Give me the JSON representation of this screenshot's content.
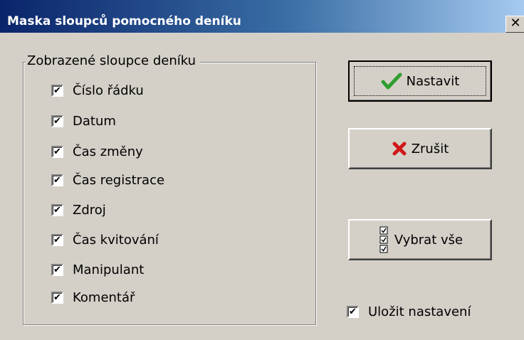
{
  "window": {
    "title": "Maska sloupců pomocného deníku",
    "close_glyph": "✕"
  },
  "group": {
    "legend": "Zobrazené sloupce deníku",
    "items": [
      {
        "label": "Číslo řádku",
        "checked": true
      },
      {
        "label": "Datum",
        "checked": true
      },
      {
        "label": "Čas změny",
        "checked": true
      },
      {
        "label": "Čas registrace",
        "checked": true
      },
      {
        "label": "Zdroj",
        "checked": true
      },
      {
        "label": "Čas kvitování",
        "checked": true
      },
      {
        "label": "Manipulant",
        "checked": true
      },
      {
        "label": "Komentář",
        "checked": true
      }
    ]
  },
  "buttons": {
    "ok": {
      "label": "Nastavit",
      "icon": "checkmark-icon",
      "icon_color": "#2e9e2e"
    },
    "cancel": {
      "label": "Zrušit",
      "icon": "x-icon",
      "icon_color": "#d01818"
    },
    "select_all": {
      "label": "Vybrat vše",
      "icon": "select-all-icon"
    }
  },
  "save_settings": {
    "label": "Uložit nastavení",
    "checked": true
  },
  "check_glyph": "✔"
}
